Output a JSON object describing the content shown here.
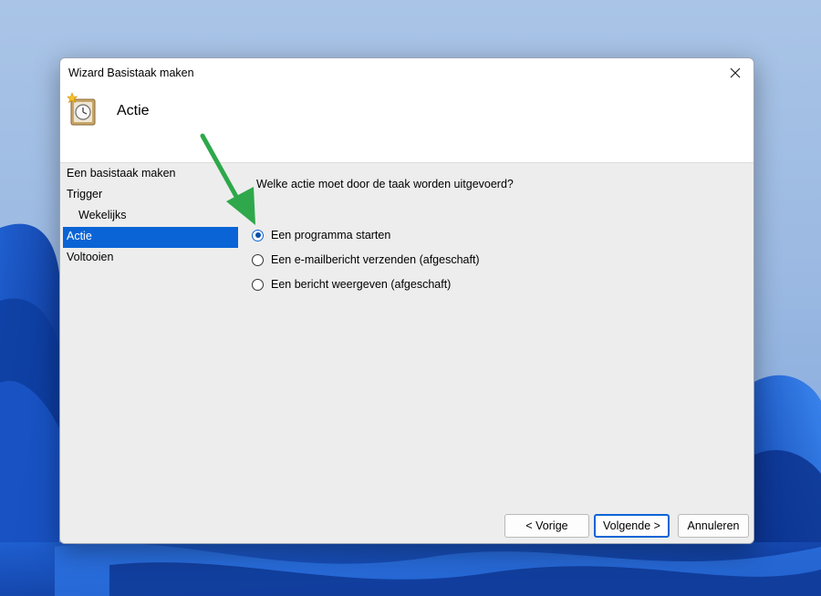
{
  "window": {
    "title": "Wizard Basistaak maken",
    "close_icon": "close-icon"
  },
  "header": {
    "title": "Actie",
    "icon": "task-scheduler-clock-icon"
  },
  "nav": {
    "items": [
      {
        "label": "Een basistaak maken",
        "active": false,
        "sub": false
      },
      {
        "label": "Trigger",
        "active": false,
        "sub": false
      },
      {
        "label": "Wekelijks",
        "active": false,
        "sub": true
      },
      {
        "label": "Actie",
        "active": true,
        "sub": false
      },
      {
        "label": "Voltooien",
        "active": false,
        "sub": false
      }
    ]
  },
  "content": {
    "question": "Welke actie moet door de taak worden uitgevoerd?",
    "options": [
      {
        "label": "Een programma starten",
        "checked": true
      },
      {
        "label": "Een e-mailbericht verzenden (afgeschaft)",
        "checked": false
      },
      {
        "label": "Een bericht weergeven (afgeschaft)",
        "checked": false
      }
    ]
  },
  "buttons": {
    "back": "< Vorige",
    "next": "Volgende >",
    "cancel": "Annuleren"
  },
  "colors": {
    "accent": "#0a64d6",
    "annotation_arrow": "#2ea84a"
  }
}
